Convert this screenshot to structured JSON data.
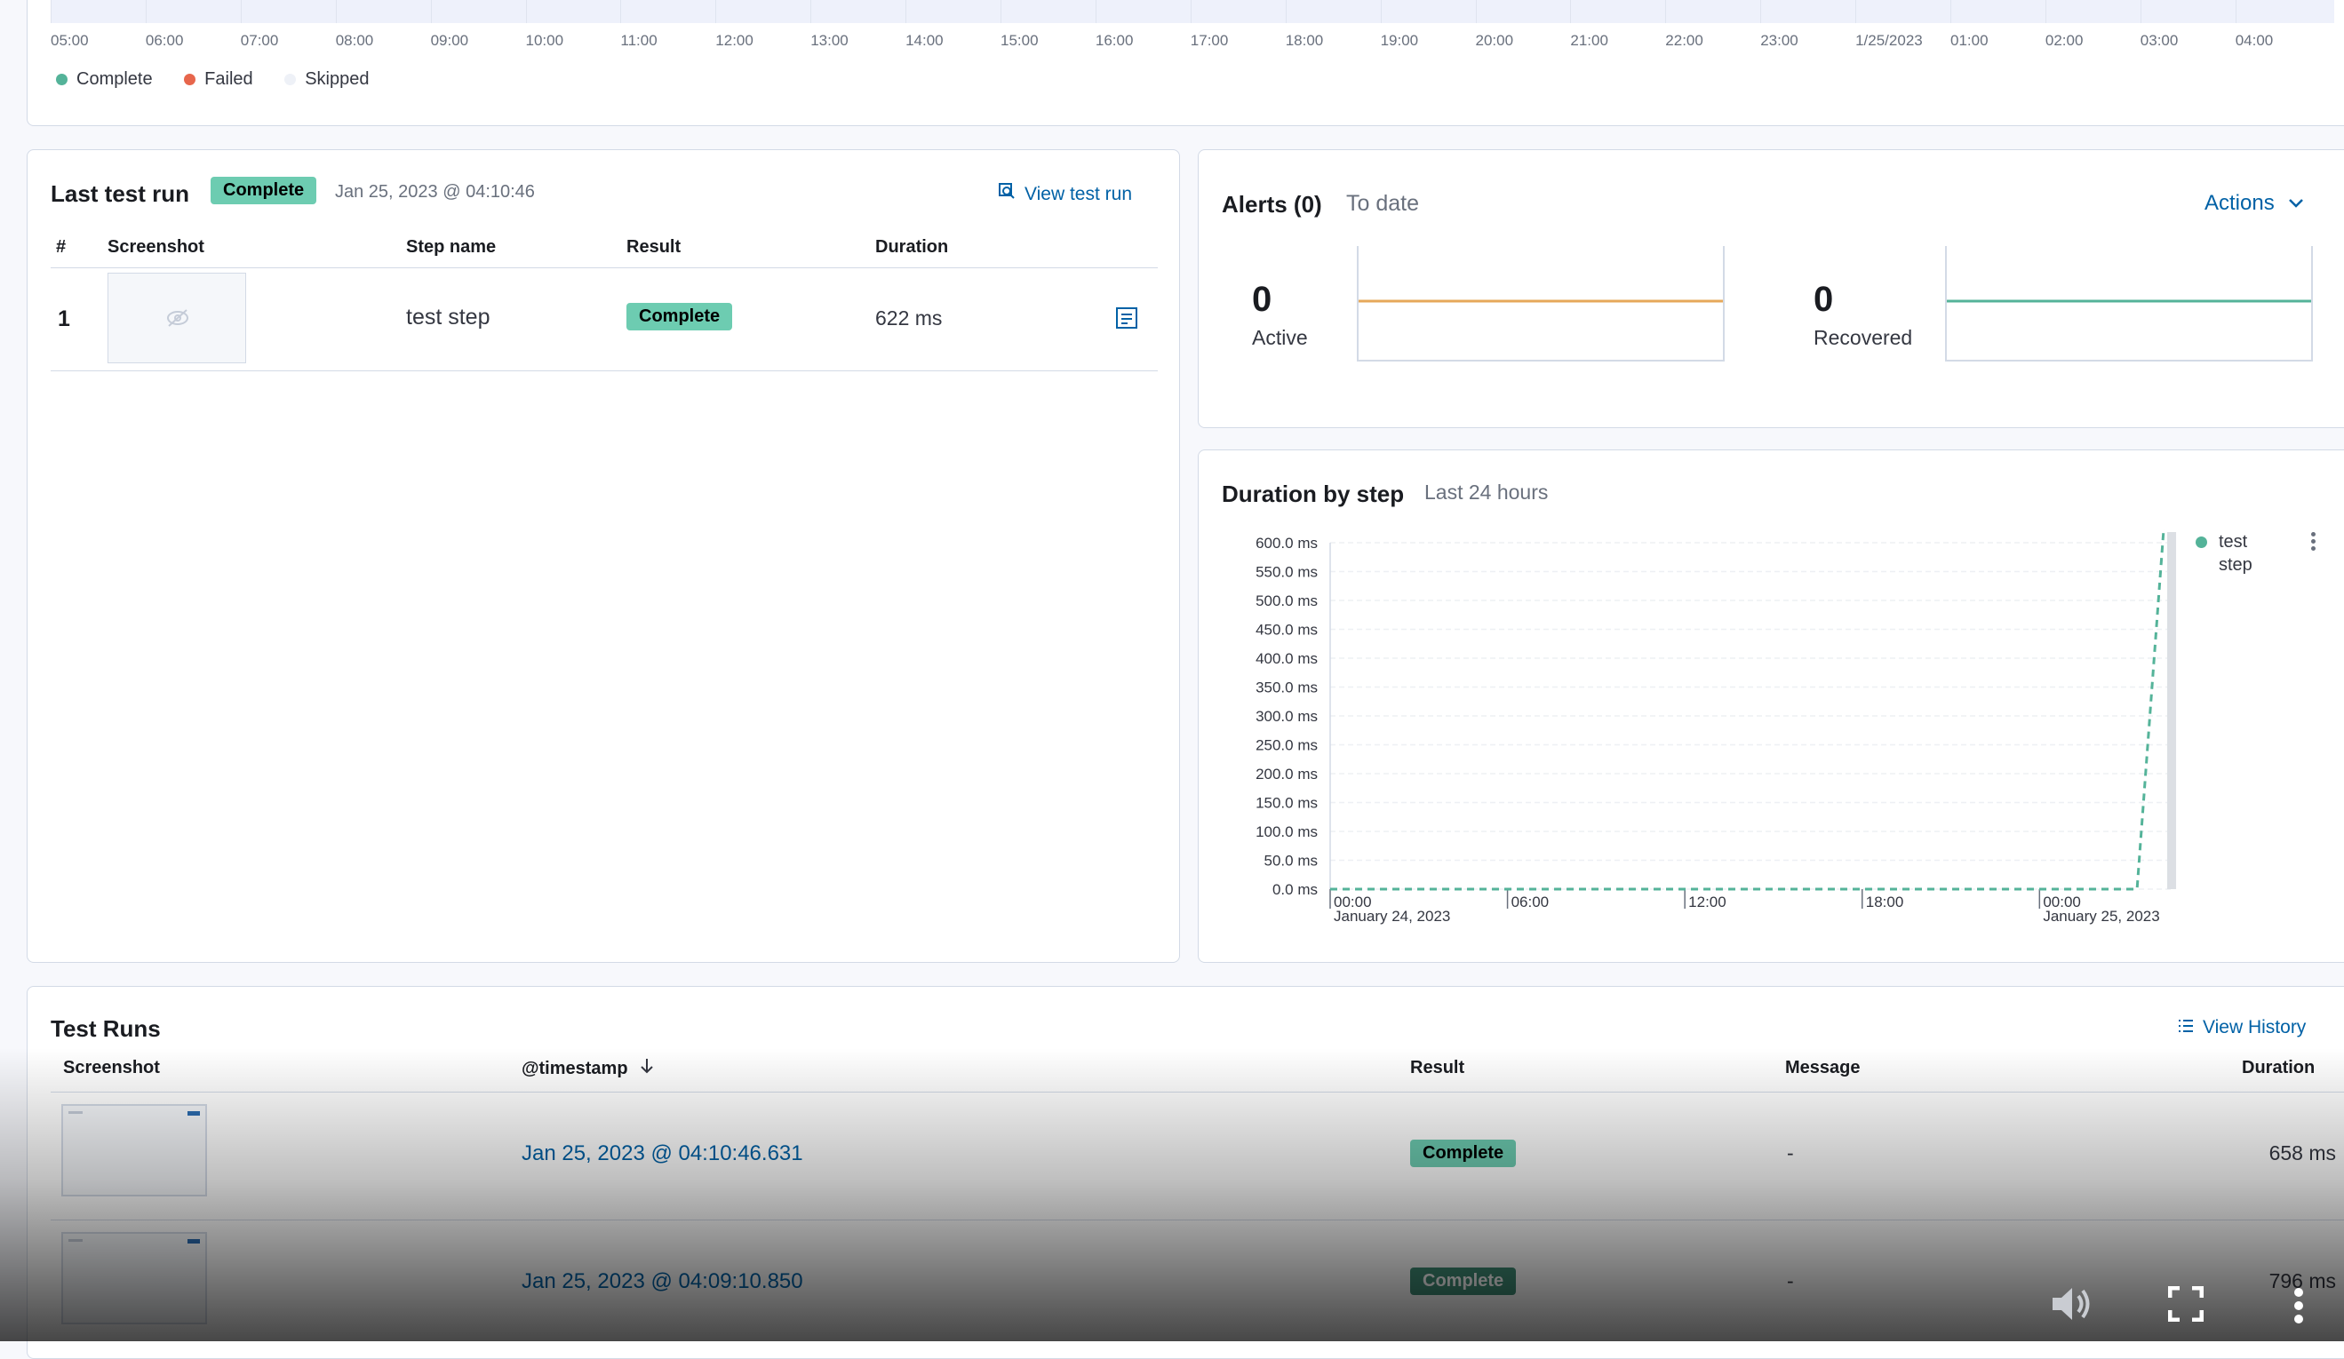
{
  "timeline": {
    "ticks": [
      "05:00",
      "06:00",
      "07:00",
      "08:00",
      "09:00",
      "10:00",
      "11:00",
      "12:00",
      "13:00",
      "14:00",
      "15:00",
      "16:00",
      "17:00",
      "18:00",
      "19:00",
      "20:00",
      "21:00",
      "22:00",
      "23:00",
      "1/25/2023",
      "01:00",
      "02:00",
      "03:00",
      "04:00"
    ],
    "legend": [
      {
        "label": "Complete",
        "color": "#54b399"
      },
      {
        "label": "Failed",
        "color": "#e7664c"
      },
      {
        "label": "Skipped",
        "color": "#eef1f7"
      }
    ]
  },
  "last_test_run": {
    "title": "Last test run",
    "status": "Complete",
    "date": "Jan 25, 2023 @ 04:10:46",
    "view_label": "View test run",
    "columns": [
      "#",
      "Screenshot",
      "Step name",
      "Result",
      "Duration"
    ],
    "rows": [
      {
        "num": "1",
        "step": "test step",
        "result": "Complete",
        "duration": "622 ms"
      }
    ]
  },
  "alerts": {
    "title": "Alerts (0)",
    "subtitle": "To date",
    "actions_label": "Actions",
    "active_value": "0",
    "active_label": "Active",
    "recovered_value": "0",
    "recovered_label": "Recovered",
    "active_color": "#e6a85a",
    "recovered_color": "#54b399"
  },
  "duration_chart": {
    "title": "Duration by step",
    "subtitle": "Last 24 hours",
    "legend_line1": "test",
    "legend_line2": "step"
  },
  "chart_data": {
    "type": "line",
    "title": "Duration by step",
    "subtitle": "Last 24 hours",
    "y_ticks": [
      "0.0 ms",
      "50.0 ms",
      "100.0 ms",
      "150.0 ms",
      "200.0 ms",
      "250.0 ms",
      "300.0 ms",
      "350.0 ms",
      "400.0 ms",
      "450.0 ms",
      "500.0 ms",
      "550.0 ms",
      "600.0 ms"
    ],
    "ylim": [
      0,
      600
    ],
    "x_ticks": [
      {
        "top": "00:00",
        "bottom": "January 24, 2023"
      },
      {
        "top": "06:00",
        "bottom": ""
      },
      {
        "top": "12:00",
        "bottom": ""
      },
      {
        "top": "18:00",
        "bottom": ""
      },
      {
        "top": "00:00",
        "bottom": "January 25, 2023"
      }
    ],
    "xlim_hours": [
      0,
      28.5
    ],
    "series": [
      {
        "name": "test step",
        "color": "#54b399",
        "points": [
          [
            0,
            0
          ],
          [
            27.3,
            0
          ],
          [
            28.2,
            622
          ]
        ]
      }
    ],
    "grid": true,
    "legend_position": "top-right"
  },
  "test_runs": {
    "title": "Test Runs",
    "view_history_label": "View History",
    "columns": [
      "Screenshot",
      "@timestamp",
      "Result",
      "Message",
      "Duration"
    ],
    "rows": [
      {
        "timestamp": "Jan 25, 2023 @ 04:10:46.631",
        "result": "Complete",
        "message": "-",
        "duration": "658 ms"
      },
      {
        "timestamp": "Jan 25, 2023 @ 04:09:10.850",
        "result": "Complete",
        "message": "-",
        "duration": "796 ms"
      }
    ]
  }
}
